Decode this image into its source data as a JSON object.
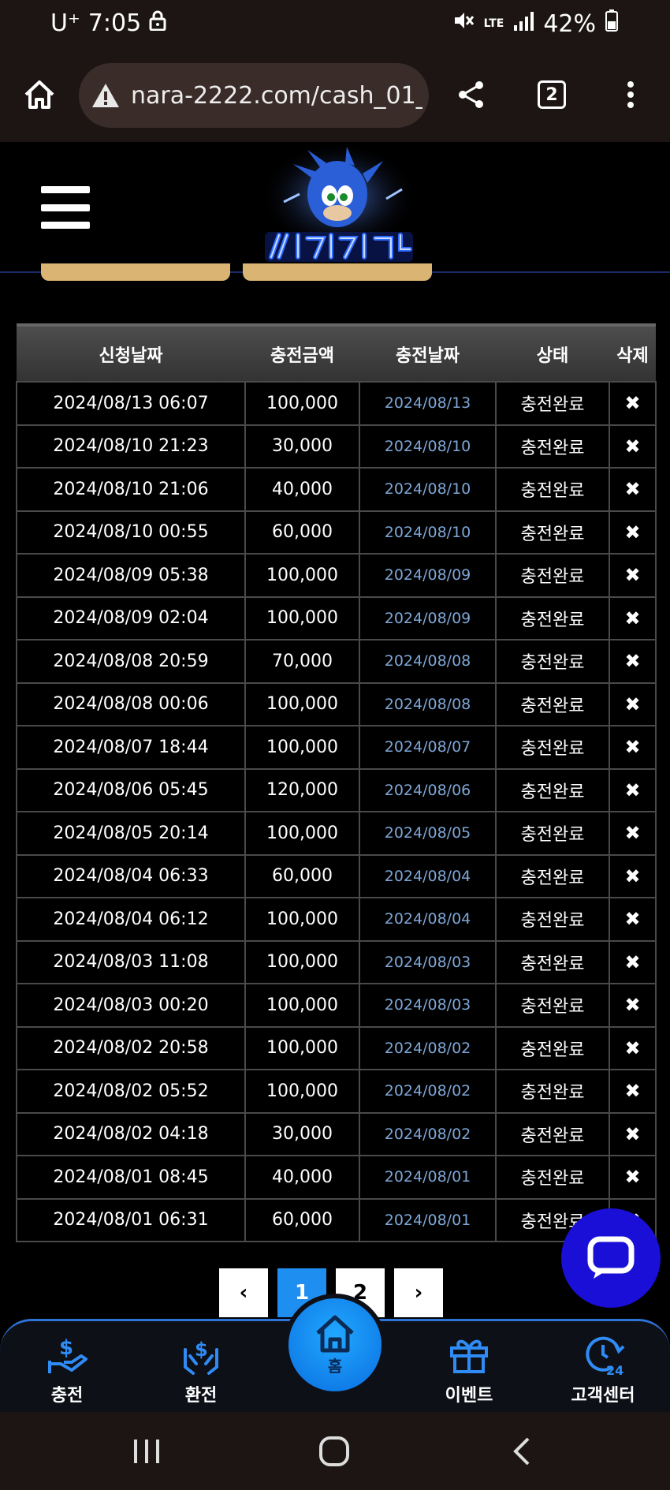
{
  "status": {
    "carrier": "U⁺",
    "time": "7:05",
    "network": "LTE",
    "battery": "42%"
  },
  "browser": {
    "url": "nara-2222.com/cash_01_1.",
    "tab_count": "2"
  },
  "table": {
    "headers": [
      "신청날짜",
      "충전금액",
      "충전날짜",
      "상태",
      "삭제"
    ],
    "rows": [
      [
        "2024/08/13 06:07",
        "100,000",
        "2024/08/13",
        "충전완료",
        "✖"
      ],
      [
        "2024/08/10 21:23",
        "30,000",
        "2024/08/10",
        "충전완료",
        "✖"
      ],
      [
        "2024/08/10 21:06",
        "40,000",
        "2024/08/10",
        "충전완료",
        "✖"
      ],
      [
        "2024/08/10 00:55",
        "60,000",
        "2024/08/10",
        "충전완료",
        "✖"
      ],
      [
        "2024/08/09 05:38",
        "100,000",
        "2024/08/09",
        "충전완료",
        "✖"
      ],
      [
        "2024/08/09 02:04",
        "100,000",
        "2024/08/09",
        "충전완료",
        "✖"
      ],
      [
        "2024/08/08 20:59",
        "70,000",
        "2024/08/08",
        "충전완료",
        "✖"
      ],
      [
        "2024/08/08 00:06",
        "100,000",
        "2024/08/08",
        "충전완료",
        "✖"
      ],
      [
        "2024/08/07 18:44",
        "100,000",
        "2024/08/07",
        "충전완료",
        "✖"
      ],
      [
        "2024/08/06 05:45",
        "120,000",
        "2024/08/06",
        "충전완료",
        "✖"
      ],
      [
        "2024/08/05 20:14",
        "100,000",
        "2024/08/05",
        "충전완료",
        "✖"
      ],
      [
        "2024/08/04 06:33",
        "60,000",
        "2024/08/04",
        "충전완료",
        "✖"
      ],
      [
        "2024/08/04 06:12",
        "100,000",
        "2024/08/04",
        "충전완료",
        "✖"
      ],
      [
        "2024/08/03 11:08",
        "100,000",
        "2024/08/03",
        "충전완료",
        "✖"
      ],
      [
        "2024/08/03 00:20",
        "100,000",
        "2024/08/03",
        "충전완료",
        "✖"
      ],
      [
        "2024/08/02 20:58",
        "100,000",
        "2024/08/02",
        "충전완료",
        "✖"
      ],
      [
        "2024/08/02 05:52",
        "100,000",
        "2024/08/02",
        "충전완료",
        "✖"
      ],
      [
        "2024/08/02 04:18",
        "30,000",
        "2024/08/02",
        "충전완료",
        "✖"
      ],
      [
        "2024/08/01 08:45",
        "40,000",
        "2024/08/01",
        "충전완료",
        "✖"
      ],
      [
        "2024/08/01 06:31",
        "60,000",
        "2024/08/01",
        "충전완료",
        "✖"
      ]
    ]
  },
  "pager": {
    "prev": "‹",
    "pages": [
      "1",
      "2"
    ],
    "next": "›"
  },
  "bottom_nav": {
    "charge": "충전",
    "exchange": "환전",
    "home": "홈",
    "event": "이벤트",
    "support": "고객센터"
  },
  "colors": {
    "accent": "#1f8ef1",
    "chat": "#1a0fd6",
    "date_link": "#7ea6d6"
  }
}
